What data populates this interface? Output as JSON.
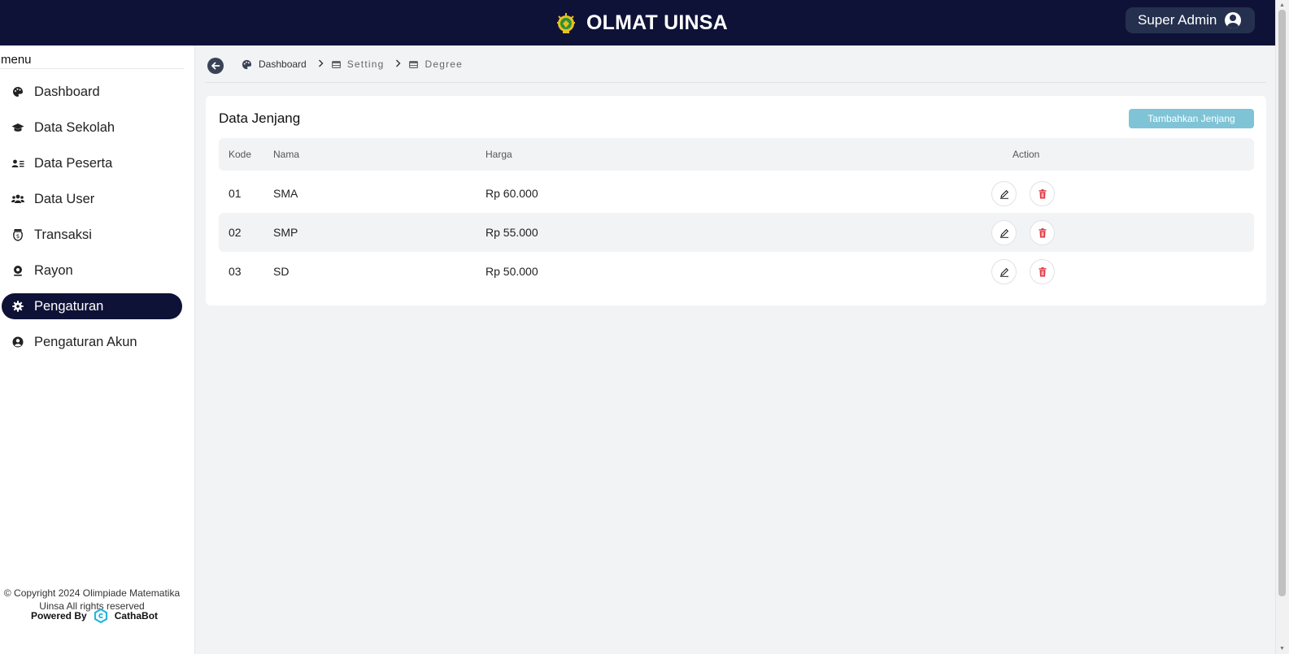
{
  "header": {
    "app_title": "OLMAT UINSA",
    "logo_icon": "uinsa-logo-icon",
    "user_label": "Super Admin",
    "user_icon": "user-circle-icon"
  },
  "sidebar": {
    "menu_label": "menu",
    "items": [
      {
        "label": "Dashboard",
        "icon": "palette-icon",
        "active": false
      },
      {
        "label": "Data Sekolah",
        "icon": "graduation-cap-icon",
        "active": false
      },
      {
        "label": "Data Peserta",
        "icon": "address-card-icon",
        "active": false
      },
      {
        "label": "Data User",
        "icon": "users-icon",
        "active": false
      },
      {
        "label": "Transaksi",
        "icon": "money-bill-icon",
        "active": false
      },
      {
        "label": "Rayon",
        "icon": "location-pin-icon",
        "active": false
      },
      {
        "label": "Pengaturan",
        "icon": "gear-icon",
        "active": true
      },
      {
        "label": "Pengaturan Akun",
        "icon": "user-circle-icon",
        "active": false
      }
    ],
    "footer": {
      "copyright": "© Copyright 2024 Olimpiade Matematika Uinsa All rights reserved",
      "powered_by": "Powered By",
      "brand": "CathaBot"
    }
  },
  "breadcrumb": {
    "back_icon": "arrow-left-icon",
    "items": [
      {
        "label": "Dashboard",
        "icon": "palette-icon"
      },
      {
        "label": "Setting",
        "icon": "table-icon"
      },
      {
        "label": "Degree",
        "icon": "table-icon"
      }
    ]
  },
  "main": {
    "card_title": "Data Jenjang",
    "add_button": "Tambahkan Jenjang",
    "table": {
      "columns": [
        "Kode",
        "Nama",
        "Harga",
        "Action"
      ],
      "rows": [
        {
          "kode": "01",
          "nama": "SMA",
          "harga": "Rp 60.000"
        },
        {
          "kode": "02",
          "nama": "SMP",
          "harga": "Rp 55.000"
        },
        {
          "kode": "03",
          "nama": "SD",
          "harga": "Rp 50.000"
        }
      ],
      "edit_icon": "pencil-icon",
      "delete_icon": "trash-icon"
    }
  },
  "colors": {
    "navy": "#0f1237",
    "accent_button": "#7fc4d6",
    "delete_red": "#e0353f",
    "background": "#f2f3f5"
  }
}
